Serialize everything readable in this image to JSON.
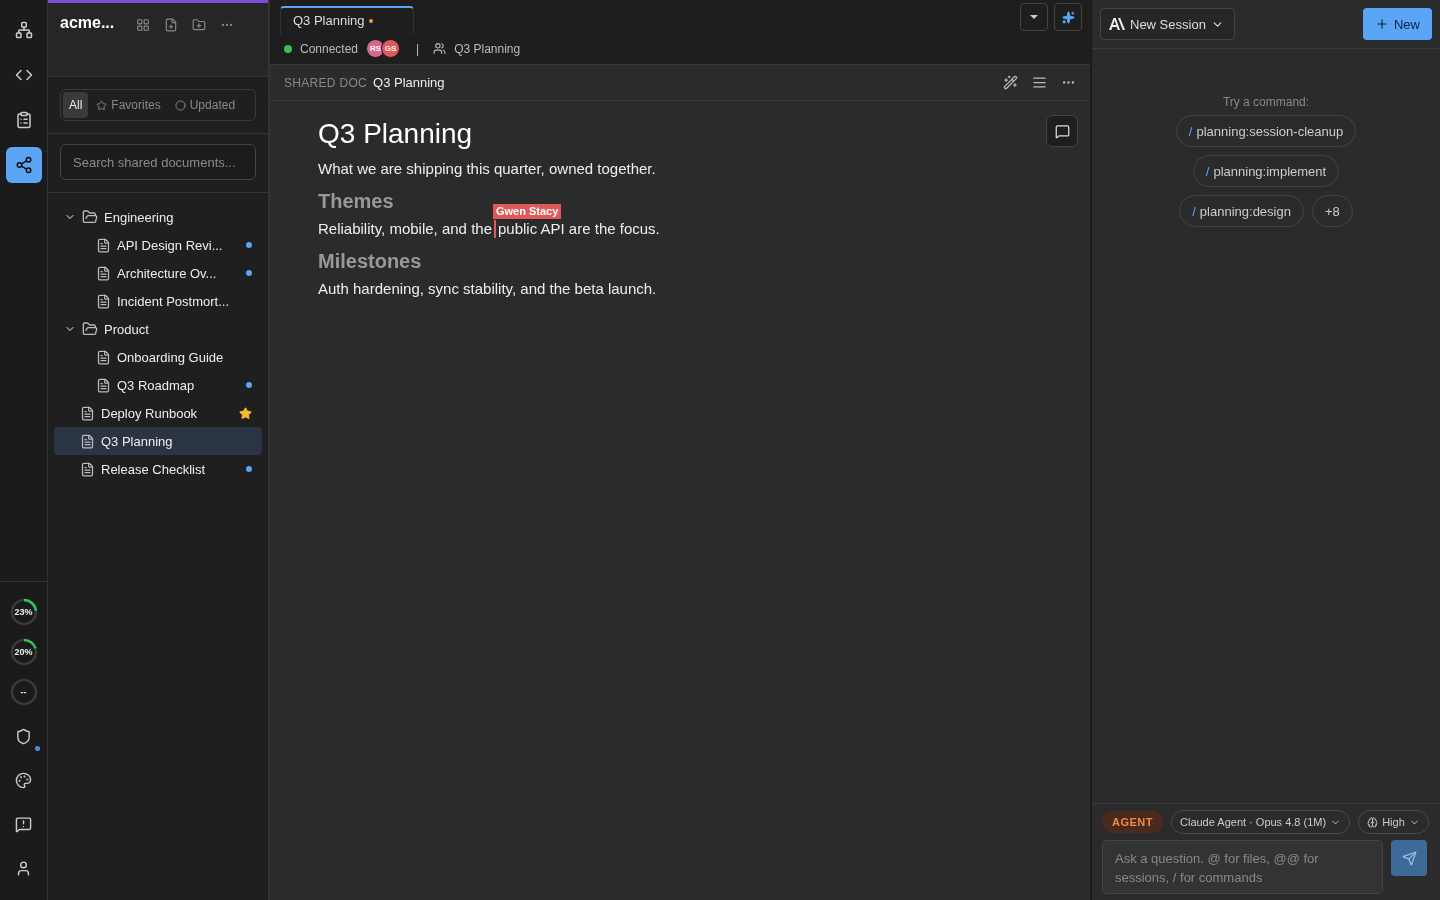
{
  "rail": {
    "items": [
      {
        "kind": "diagram",
        "selected": false
      },
      {
        "kind": "code",
        "selected": false
      },
      {
        "kind": "clipboard",
        "selected": false
      },
      {
        "kind": "share",
        "selected": true
      }
    ],
    "meters": [
      {
        "kind": "ring",
        "reading": "23%",
        "level": 0.23
      },
      {
        "kind": "ring",
        "reading": "20%",
        "level": 0.2
      },
      {
        "kind": "empty",
        "reading": "--"
      }
    ],
    "bottom": [
      {
        "kind": "shield",
        "alert": true
      },
      {
        "kind": "palette"
      },
      {
        "kind": "feedback"
      },
      {
        "kind": "user"
      }
    ]
  },
  "sidebar": {
    "title": "acme...",
    "filters": [
      {
        "kind": "all",
        "label": "All",
        "selected": true
      },
      {
        "kind": "favorites",
        "label": "Favorites",
        "selected": false
      },
      {
        "kind": "updated",
        "label": "Updated",
        "selected": false
      }
    ],
    "search": {
      "placeholder": "Search shared documents..."
    },
    "tree": [
      {
        "kind": "folder",
        "label": "Engineering",
        "expanded": true,
        "children": [
          {
            "kind": "doc",
            "label": "API Design Revi...",
            "unread": true,
            "favorite": false,
            "selected": false
          },
          {
            "kind": "doc",
            "label": "Architecture Ov...",
            "unread": true,
            "favorite": false,
            "selected": false
          },
          {
            "kind": "doc",
            "label": "Incident Postmort...",
            "unread": false,
            "favorite": false,
            "selected": false
          }
        ]
      },
      {
        "kind": "folder",
        "label": "Product",
        "expanded": true,
        "children": [
          {
            "kind": "doc",
            "label": "Onboarding Guide",
            "unread": false,
            "favorite": false,
            "selected": false
          },
          {
            "kind": "doc",
            "label": "Q3 Roadmap",
            "unread": true,
            "favorite": false,
            "selected": false
          }
        ]
      },
      {
        "kind": "doc",
        "label": "Deploy Runbook",
        "unread": false,
        "favorite": true,
        "selected": false
      },
      {
        "kind": "doc",
        "label": "Q3 Planning",
        "unread": false,
        "favorite": false,
        "selected": true
      },
      {
        "kind": "doc",
        "label": "Release Checklist",
        "unread": true,
        "favorite": false,
        "selected": false
      }
    ]
  },
  "editor": {
    "tabs": [
      {
        "label": "Q3 Planning",
        "modified": true,
        "selected": true
      }
    ],
    "status": {
      "label": "Connected",
      "connected": true,
      "avatars": [
        {
          "initials": "RS",
          "color": "#d9668f"
        },
        {
          "initials": "GS",
          "color": "#e05a5a"
        }
      ],
      "separator": "|",
      "room": "Q3 Planning"
    },
    "breadcrumb": {
      "kind_label": "SHARED DOC",
      "title": "Q3 Planning"
    },
    "doc": [
      {
        "kind": "h1",
        "text": "Q3 Planning"
      },
      {
        "kind": "p",
        "text": "What we are shipping this quarter, owned together."
      },
      {
        "kind": "h2",
        "text": "Themes"
      },
      {
        "kind": "cursor_p",
        "before": "Reliability, mobile, and the",
        "after": "public API are the focus.",
        "cursor": {
          "name": "Gwen Stacy",
          "color": "#e05a5a"
        }
      },
      {
        "kind": "h2",
        "text": "Milestones"
      },
      {
        "kind": "p",
        "text": "Auth hardening, sync stability, and the beta launch."
      }
    ]
  },
  "assistant": {
    "session": "New Session",
    "new_button": "New",
    "prompt": "Try a command:",
    "commands": [
      {
        "slash": "/",
        "name": "planning:session-cleanup"
      },
      {
        "slash": "/",
        "name": "planning:implement"
      },
      {
        "slash": "/",
        "name": "planning:design"
      }
    ],
    "more": "+8",
    "mode": "AGENT",
    "model": "Claude Agent · Opus 4.8 (1M)",
    "effort": "High",
    "input": {
      "placeholder": "Ask a question. @ for files, @@ for sessions, / for commands"
    }
  }
}
